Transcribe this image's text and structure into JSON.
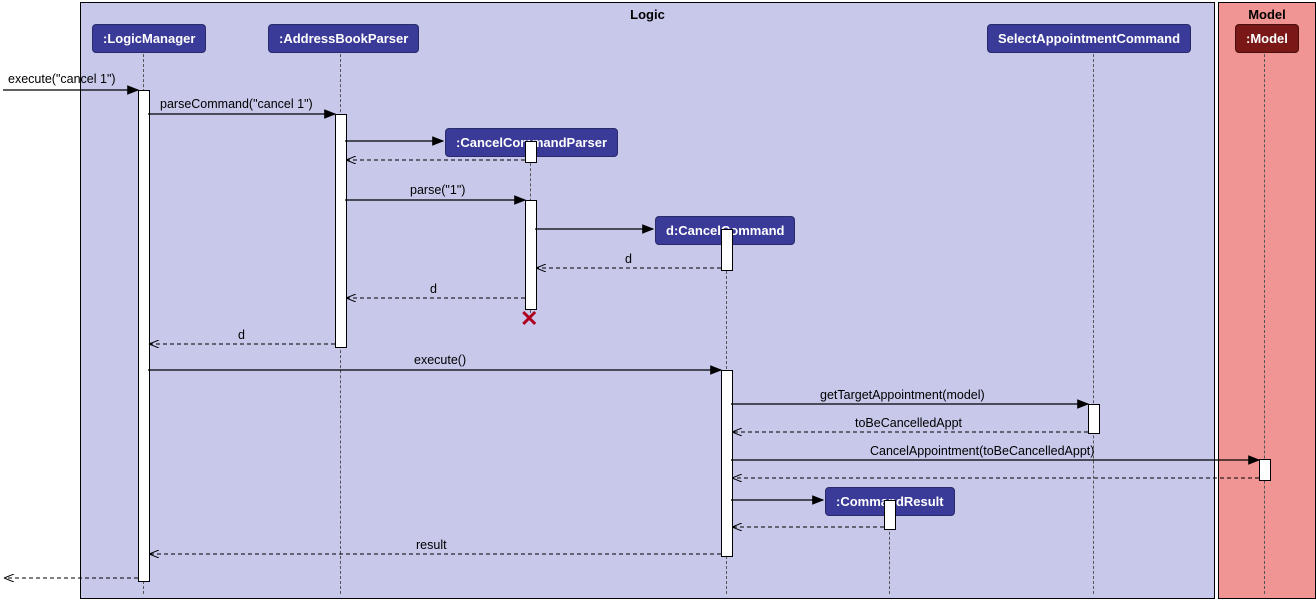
{
  "frames": {
    "logic": "Logic",
    "model": "Model"
  },
  "participants": {
    "logicManager": ":LogicManager",
    "addressBookParser": ":AddressBookParser",
    "cancelCommandParser": ":CancelCommandParser",
    "cancelCommand": "d:CancelCommand",
    "selectAppointmentCommand": "SelectAppointmentCommand",
    "commandResult": ":CommandResult",
    "model": ":Model"
  },
  "messages": {
    "execute1": "execute(\"cancel 1\")",
    "parseCommand": "parseCommand(\"cancel 1\")",
    "parse": "parse(\"1\")",
    "d1": "d",
    "d2": "d",
    "d3": "d",
    "execute2": "execute()",
    "getTarget": "getTargetAppointment(model)",
    "toBeCancelled": "toBeCancelledAppt",
    "cancelAppt": "CancelAppointment(toBeCancelledAppt)",
    "result": "result"
  }
}
